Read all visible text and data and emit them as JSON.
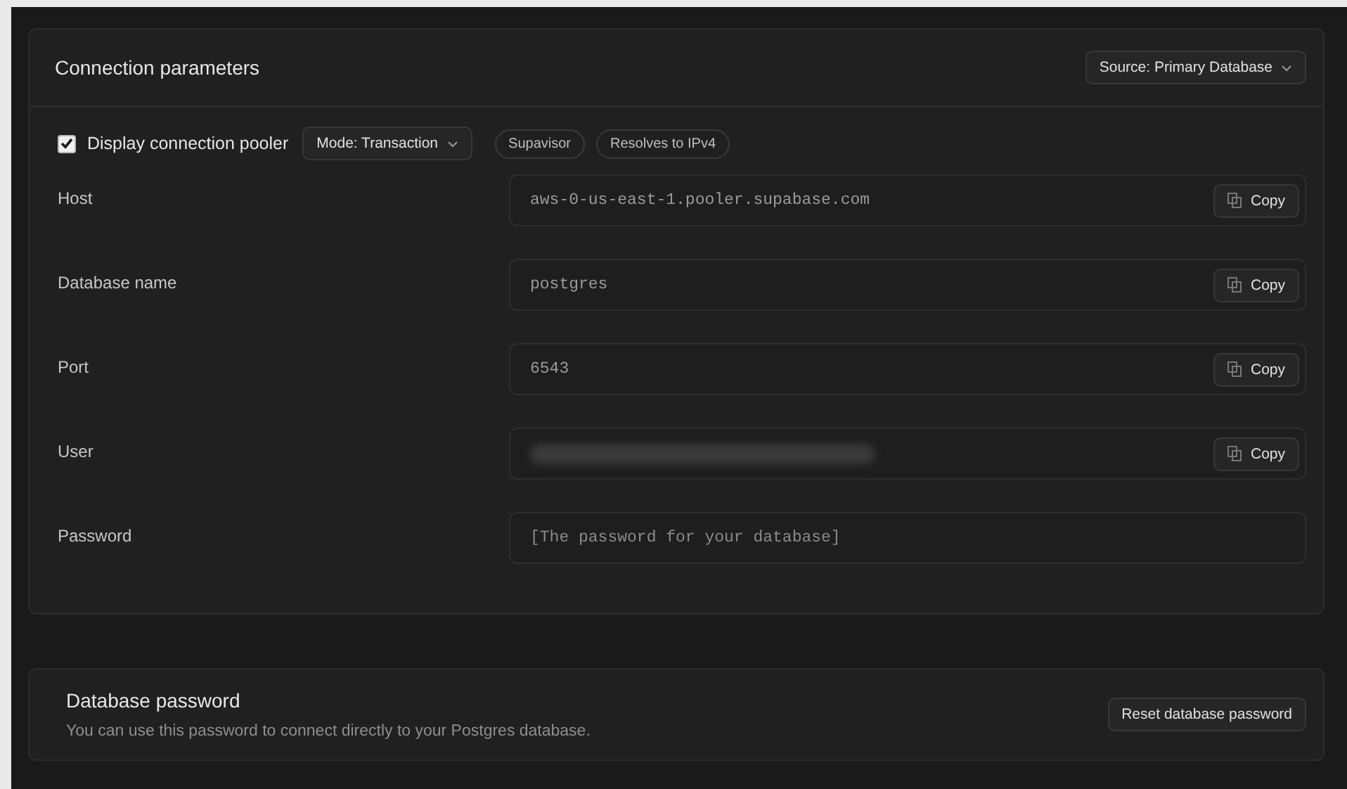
{
  "connection": {
    "title": "Connection parameters",
    "source": "Source: Primary Database",
    "pooler": {
      "checked": true,
      "label": "Display connection pooler",
      "mode": "Mode: Transaction",
      "badges": [
        "Supavisor",
        "Resolves to IPv4"
      ]
    },
    "fields": [
      {
        "label": "Host",
        "kind": "text",
        "value": "aws-0-us-east-1.pooler.supabase.com",
        "copy": "Copy"
      },
      {
        "label": "Database name",
        "kind": "text",
        "value": "postgres",
        "copy": "Copy"
      },
      {
        "label": "Port",
        "kind": "text",
        "value": "6543",
        "copy": "Copy"
      },
      {
        "label": "User",
        "kind": "redacted",
        "copy": "Copy"
      },
      {
        "label": "Password",
        "kind": "placeholder",
        "placeholder": "[The password for your database]"
      }
    ]
  },
  "password": {
    "title": "Database password",
    "description": "You can use this password to connect directly to your Postgres database.",
    "button": "Reset database password"
  }
}
